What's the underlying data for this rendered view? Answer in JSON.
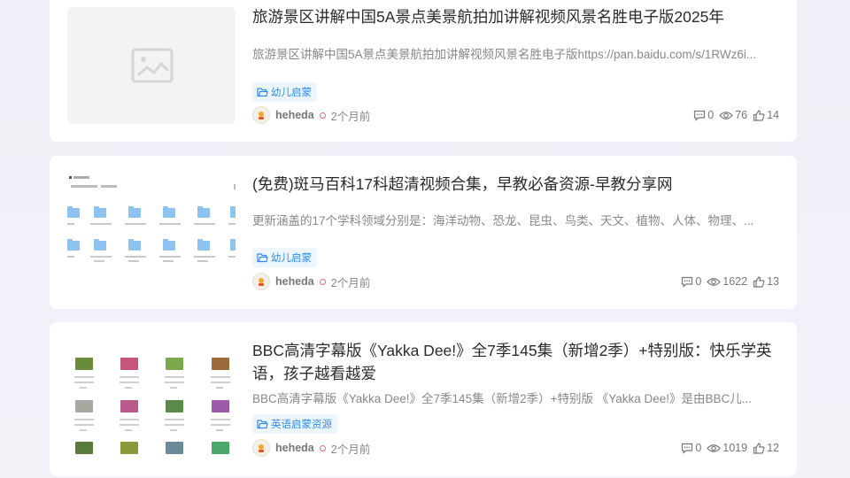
{
  "posts": [
    {
      "title": "旅游景区讲解中国5A景点美景航拍加讲解视频风景名胜电子版2025年",
      "excerpt": "旅游景区讲解中国5A景点美景航拍加讲解视频风景名胜电子版https://pan.baidu.com/s/1RWz6i...",
      "tag": "幼儿启蒙",
      "author": "heheda",
      "time": "2个月前",
      "comments": "0",
      "views": "76",
      "likes": "14",
      "thumb": "image-placeholder-icon"
    },
    {
      "title": "(免费)斑马百科17科超清视频合集，早教必备资源-早教分享网",
      "excerpt": "更新涵盖的17个学科领域分别是：海洋动物、恐龙、昆虫、鸟类、天文、植物、人体、物理、...",
      "tag": "幼儿启蒙",
      "author": "heheda",
      "time": "2个月前",
      "comments": "0",
      "views": "1622",
      "likes": "13",
      "thumb": "folder-grid"
    },
    {
      "title": "BBC高清字幕版《Yakka Dee!》全7季145集（新增2季）+特别版：快乐学英语，孩子越看越爱",
      "excerpt": "BBC高清字幕版《Yakka Dee!》全7季145集（新增2季）+特别版 《Yakka Dee!》是由BBC儿...",
      "tag": "英语启蒙资源",
      "author": "heheda",
      "time": "2个月前",
      "comments": "0",
      "views": "1019",
      "likes": "12",
      "thumb": "cartoon-grid"
    }
  ],
  "colors": {
    "accent": "#2d8cf0",
    "tag_bg": "#eef6fd",
    "time_dot": "#e86a8a",
    "folder": "#8fc3ef"
  },
  "icons": [
    "folder-icon",
    "comment-icon",
    "eye-icon",
    "thumbs-up-icon",
    "avatar-icon",
    "image-placeholder-icon"
  ]
}
